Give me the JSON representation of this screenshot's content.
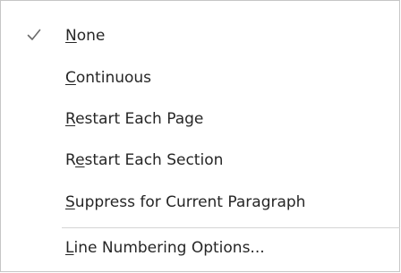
{
  "menu": {
    "items": [
      {
        "access_key": "N",
        "rest": "one",
        "checked": true,
        "check_icon": "checkmark-icon"
      },
      {
        "access_key": "C",
        "rest": "ontinuous",
        "checked": false
      },
      {
        "access_key": "R",
        "rest": "estart Each Page",
        "checked": false
      },
      {
        "pre": "R",
        "access_key": "e",
        "rest": "start Each Section",
        "checked": false
      },
      {
        "access_key": "S",
        "rest": "uppress for Current Paragraph",
        "checked": false
      }
    ],
    "options_item": {
      "access_key": "L",
      "rest": "ine Numbering Options..."
    }
  }
}
